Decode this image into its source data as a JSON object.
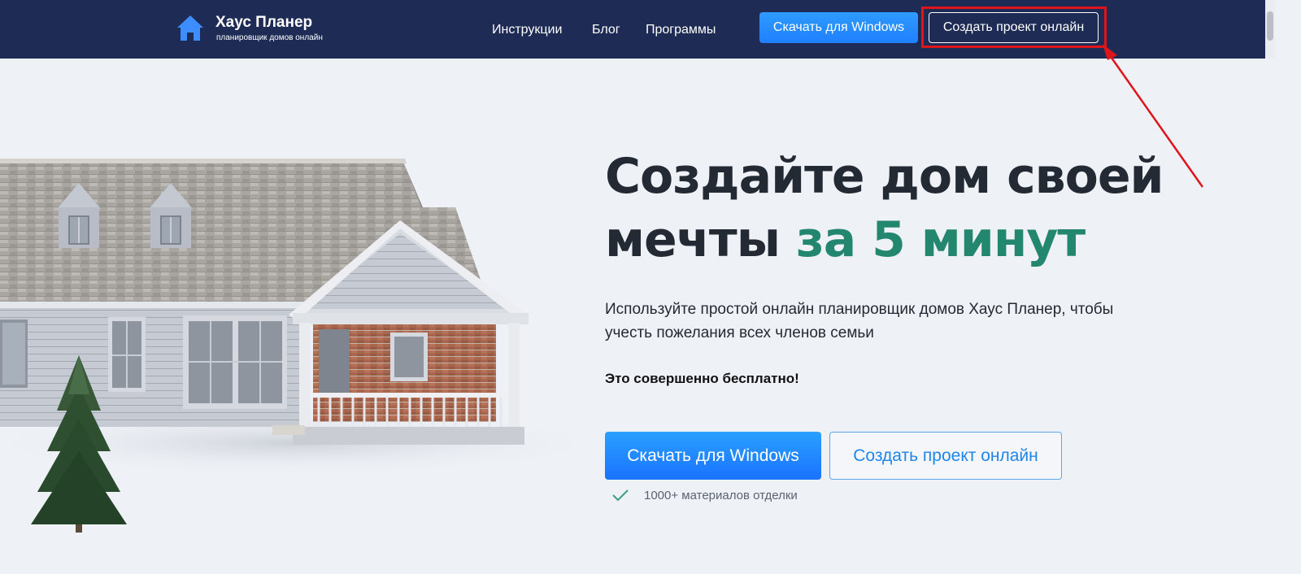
{
  "header": {
    "brand_name": "Хаус Планер",
    "brand_subtitle": "планировщик домов онлайн",
    "nav": [
      {
        "label": "Инструкции"
      },
      {
        "label": "Блог"
      },
      {
        "label": "Программы"
      }
    ],
    "download_label": "Скачать для Windows",
    "online_label": "Создать проект онлайн"
  },
  "hero": {
    "headline_part1": "Создайте дом своей мечты ",
    "headline_accent": "за 5 минут",
    "subtitle": "Используйте простой онлайн планировщик домов Хаус Планер, чтобы учесть пожелания всех членов семьи",
    "free_note": "Это совершенно бесплатно!",
    "cta_download_label": "Скачать для Windows",
    "cta_online_label": "Создать проект онлайн",
    "feature_text": "1000+ материалов отделки"
  },
  "colors": {
    "header_bg": "#1e2c55",
    "page_bg": "#eef1f6",
    "accent_green": "#23866f",
    "primary_blue": "#1f7fff",
    "annotation_red": "#e0141b"
  },
  "icons": [
    "house-logo-icon",
    "check-icon",
    "annotation-arrow"
  ]
}
